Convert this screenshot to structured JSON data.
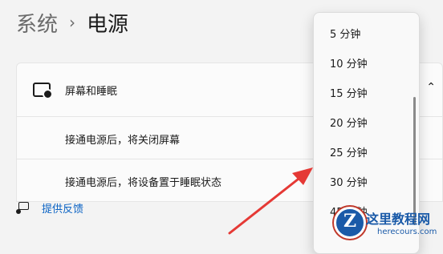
{
  "breadcrumb": {
    "root": "系统",
    "separator": "›",
    "current": "电源"
  },
  "section": {
    "header_label": "屏幕和睡眠",
    "rows": [
      {
        "label": "接通电源后，将关闭屏幕"
      },
      {
        "label": "接通电源后，将设备置于睡眠状态"
      }
    ]
  },
  "feedback": {
    "label": "提供反馈"
  },
  "dropdown": {
    "options": [
      "5 分钟",
      "10 分钟",
      "15 分钟",
      "20 分钟",
      "25 分钟",
      "30 分钟",
      "45 分钟"
    ]
  },
  "watermark": {
    "title": "这里教程网",
    "url": "herecours.com"
  },
  "colors": {
    "accent": "#0b63c4",
    "arrow": "#e53935",
    "watermark": "#1a5aa8"
  },
  "icons": [
    "screen-sleep-icon",
    "chevron-up-icon",
    "feedback-icon"
  ]
}
